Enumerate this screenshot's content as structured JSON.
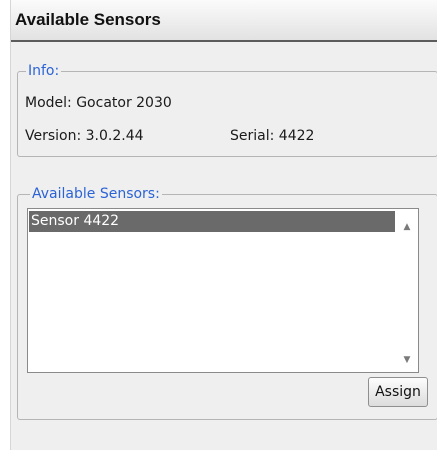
{
  "window": {
    "title": "Available Sensors"
  },
  "info": {
    "legend": "Info:",
    "model": "Model: Gocator 2030",
    "version": "Version: 3.0.2.44",
    "serial": "Serial: 4422"
  },
  "sensors": {
    "legend": "Available Sensors:",
    "items": [
      {
        "label": "Sensor 4422",
        "selected": true
      }
    ],
    "scroll_up_icon": "triangle-up",
    "scroll_down_icon": "triangle-down",
    "assign_label": "Assign"
  },
  "colors": {
    "legend_text": "#2b63d6",
    "selected_row": "#6a6a6a",
    "panel_background": "#efefef"
  }
}
